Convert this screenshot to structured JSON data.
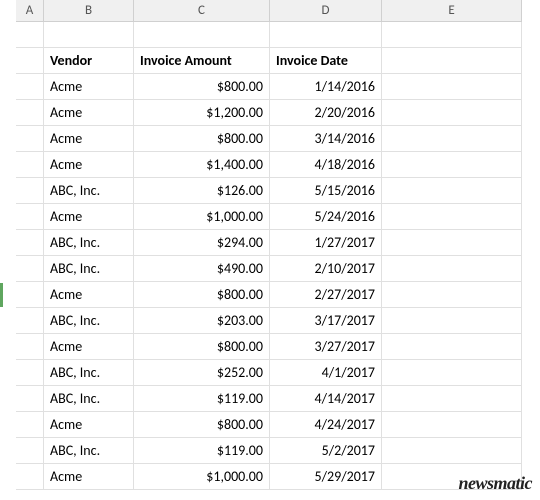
{
  "columns": [
    "A",
    "B",
    "C",
    "D",
    "E"
  ],
  "headers": {
    "vendor": "Vendor",
    "amount": "Invoice Amount",
    "date": "Invoice Date"
  },
  "rows": [
    {
      "vendor": "Acme",
      "amount": "$800.00",
      "date": "1/14/2016"
    },
    {
      "vendor": "Acme",
      "amount": "$1,200.00",
      "date": "2/20/2016"
    },
    {
      "vendor": "Acme",
      "amount": "$800.00",
      "date": "3/14/2016"
    },
    {
      "vendor": "Acme",
      "amount": "$1,400.00",
      "date": "4/18/2016"
    },
    {
      "vendor": "ABC, Inc.",
      "amount": "$126.00",
      "date": "5/15/2016"
    },
    {
      "vendor": "Acme",
      "amount": "$1,000.00",
      "date": "5/24/2016"
    },
    {
      "vendor": "ABC, Inc.",
      "amount": "$294.00",
      "date": "1/27/2017"
    },
    {
      "vendor": "ABC, Inc.",
      "amount": "$490.00",
      "date": "2/10/2017"
    },
    {
      "vendor": "Acme",
      "amount": "$800.00",
      "date": "2/27/2017"
    },
    {
      "vendor": "ABC, Inc.",
      "amount": "$203.00",
      "date": "3/17/2017"
    },
    {
      "vendor": "Acme",
      "amount": "$800.00",
      "date": "3/27/2017"
    },
    {
      "vendor": "ABC, Inc.",
      "amount": "$252.00",
      "date": "4/1/2017"
    },
    {
      "vendor": "ABC, Inc.",
      "amount": "$119.00",
      "date": "4/14/2017"
    },
    {
      "vendor": "Acme",
      "amount": "$800.00",
      "date": "4/24/2017"
    },
    {
      "vendor": "ABC, Inc.",
      "amount": "$119.00",
      "date": "5/2/2017"
    },
    {
      "vendor": "Acme",
      "amount": "$1,000.00",
      "date": "5/29/2017"
    }
  ],
  "watermark": "newsmatic"
}
